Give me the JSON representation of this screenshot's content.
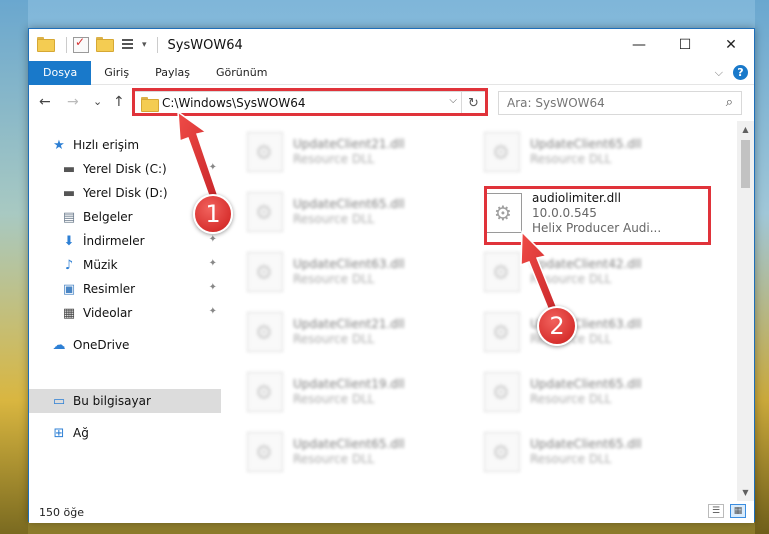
{
  "window": {
    "title": "SysWOW64",
    "caption": {
      "minimize": "—",
      "maximize": "☐",
      "close": "✕"
    }
  },
  "ribbon": {
    "tabs": [
      "Dosya",
      "Giriş",
      "Paylaş",
      "Görünüm"
    ],
    "collapse": "⌵",
    "help": "?"
  },
  "nav": {
    "back": "←",
    "forward": "→",
    "recent": "⌄",
    "up": "↑",
    "address": "C:\\Windows\\SysWOW64",
    "address_dropdown": "⌵",
    "refresh": "↻",
    "search_placeholder": "Ara: SysWOW64",
    "search_icon": "⌕"
  },
  "sidebar": {
    "items": [
      {
        "label": "Hızlı erişim",
        "icon": "star-icon",
        "glyph": "★",
        "pinned": false
      },
      {
        "label": "Yerel Disk (C:)",
        "icon": "drive-icon",
        "glyph": "▬",
        "pinned": true
      },
      {
        "label": "Yerel Disk (D:)",
        "icon": "drive-icon",
        "glyph": "▬",
        "pinned": true
      },
      {
        "label": "Belgeler",
        "icon": "documents-icon",
        "glyph": "▤",
        "pinned": true
      },
      {
        "label": "İndirmeler",
        "icon": "download-icon",
        "glyph": "⬇",
        "pinned": true
      },
      {
        "label": "Müzik",
        "icon": "music-icon",
        "glyph": "♪",
        "pinned": true
      },
      {
        "label": "Resimler",
        "icon": "pictures-icon",
        "glyph": "▣",
        "pinned": true
      },
      {
        "label": "Videolar",
        "icon": "video-icon",
        "glyph": "▦",
        "pinned": true
      },
      {
        "label": "OneDrive",
        "icon": "cloud-icon",
        "glyph": "☁",
        "pinned": false
      },
      {
        "label": "Bu bilgisayar",
        "icon": "computer-icon",
        "glyph": "▭",
        "pinned": false
      },
      {
        "label": "Ağ",
        "icon": "network-icon",
        "glyph": "⊞",
        "pinned": false
      }
    ],
    "pin_glyph": "📌"
  },
  "files": {
    "left": [
      {
        "name": "UpdateClient21.dll",
        "desc": "Resource DLL"
      },
      {
        "name": "UpdateClient65.dll",
        "desc": "Resource DLL"
      },
      {
        "name": "UpdateClient63.dll",
        "desc": "Resource DLL"
      },
      {
        "name": "UpdateClient21.dll",
        "desc": "Resource DLL"
      },
      {
        "name": "UpdateClient19.dll",
        "desc": "Resource DLL"
      },
      {
        "name": "UpdateClient65.dll",
        "desc": "Resource DLL"
      }
    ],
    "right": [
      {
        "name": "UpdateClient65.dll",
        "desc": "Resource DLL"
      },
      {
        "name": "UpdateClient42.dll",
        "desc": "Resource DLL"
      },
      {
        "name": "UpdateClient63.dll",
        "desc": "Resource DLL"
      },
      {
        "name": "UpdateClient65.dll",
        "desc": "Resource DLL"
      },
      {
        "name": "UpdateClient65.dll",
        "desc": "Resource DLL"
      }
    ],
    "target": {
      "name": "audiolimiter.dll",
      "version": "10.0.0.545",
      "desc": "Helix Producer Audi..."
    }
  },
  "status": {
    "count": "150 öğe"
  },
  "annotations": {
    "step1": "1",
    "step2": "2",
    "color": "#e0333a"
  }
}
